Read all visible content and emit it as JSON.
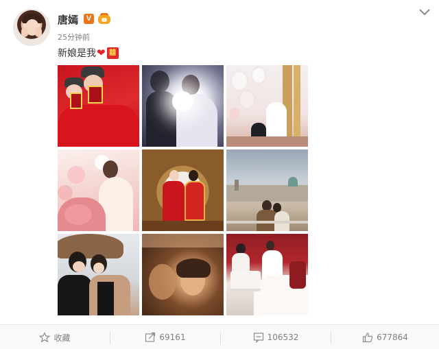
{
  "post": {
    "user_name": "唐嫣",
    "verified_badge": "V",
    "timestamp": "25分钟前",
    "text": "新娘是我",
    "heart_emoji": "❤",
    "xi_emoji": "囍"
  },
  "photos": [
    {
      "name": "photo-red-certificates"
    },
    {
      "name": "photo-couple-backlit"
    },
    {
      "name": "photo-balloon-room"
    },
    {
      "name": "photo-bride-flowers"
    },
    {
      "name": "photo-traditional-wedding"
    },
    {
      "name": "photo-city-rooftop"
    },
    {
      "name": "photo-umbrella-couple"
    },
    {
      "name": "photo-warm-closeup"
    },
    {
      "name": "photo-dinner-table"
    }
  ],
  "actions": {
    "favorite_label": "收藏",
    "repost_count": "69161",
    "comment_count": "106532",
    "like_count": "677864"
  },
  "colors": {
    "verified_orange": "#e8741c",
    "heart_red": "#e8202a",
    "muted_text": "#808080"
  }
}
